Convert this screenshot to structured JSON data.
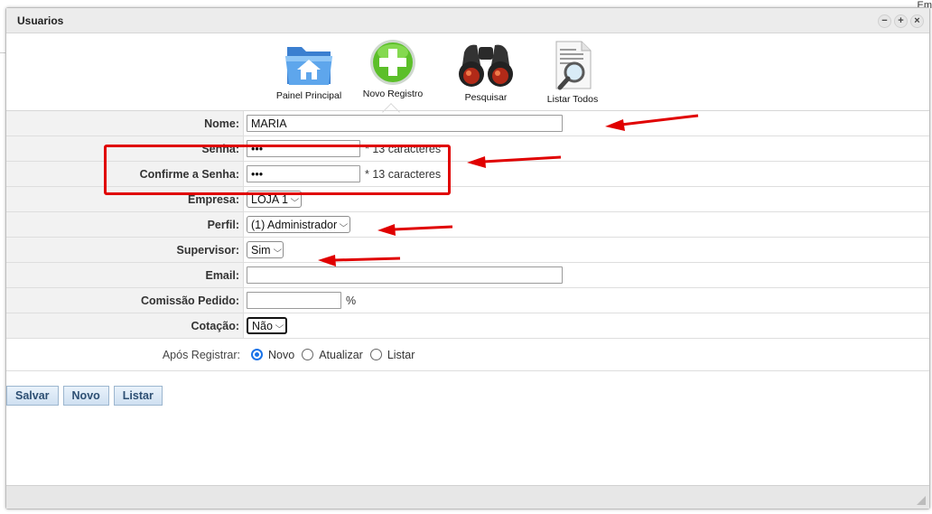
{
  "page": {
    "corner_text": "Em"
  },
  "window": {
    "title": "Usuarios",
    "controls": {
      "minimize": "−",
      "maximize": "+",
      "close": "×"
    }
  },
  "toolbar": {
    "items": [
      {
        "label": "Painel Principal",
        "icon": "home-folder-icon"
      },
      {
        "label": "Novo Registro",
        "icon": "add-circle-icon"
      },
      {
        "label": "Pesquisar",
        "icon": "binoculars-icon"
      },
      {
        "label": "Listar Todos",
        "icon": "document-search-icon"
      }
    ]
  },
  "form": {
    "nome": {
      "label": "Nome:",
      "value": "MARIA"
    },
    "senha": {
      "label": "Senha:",
      "value": "•••",
      "hint": "* 13 caracteres"
    },
    "confirme": {
      "label": "Confirme a Senha:",
      "value": "•••",
      "hint": "* 13 caracteres"
    },
    "empresa": {
      "label": "Empresa:",
      "selected": "LOJA 1"
    },
    "perfil": {
      "label": "Perfil:",
      "selected": "(1) Administrador"
    },
    "supervisor": {
      "label": "Supervisor:",
      "selected": "Sim"
    },
    "email": {
      "label": "Email:",
      "value": ""
    },
    "comissao": {
      "label": "Comissão Pedido:",
      "value": "",
      "unit": "%"
    },
    "cotacao": {
      "label": "Cotação:",
      "selected": "Não"
    },
    "apos": {
      "label": "Após Registrar:",
      "options": [
        "Novo",
        "Atualizar",
        "Listar"
      ],
      "selected": "Novo"
    }
  },
  "buttons": {
    "salvar": "Salvar",
    "novo": "Novo",
    "listar": "Listar"
  },
  "colors": {
    "annotation": "#e00000",
    "radio_accent": "#1a73e8",
    "button_text": "#2d4f73"
  }
}
